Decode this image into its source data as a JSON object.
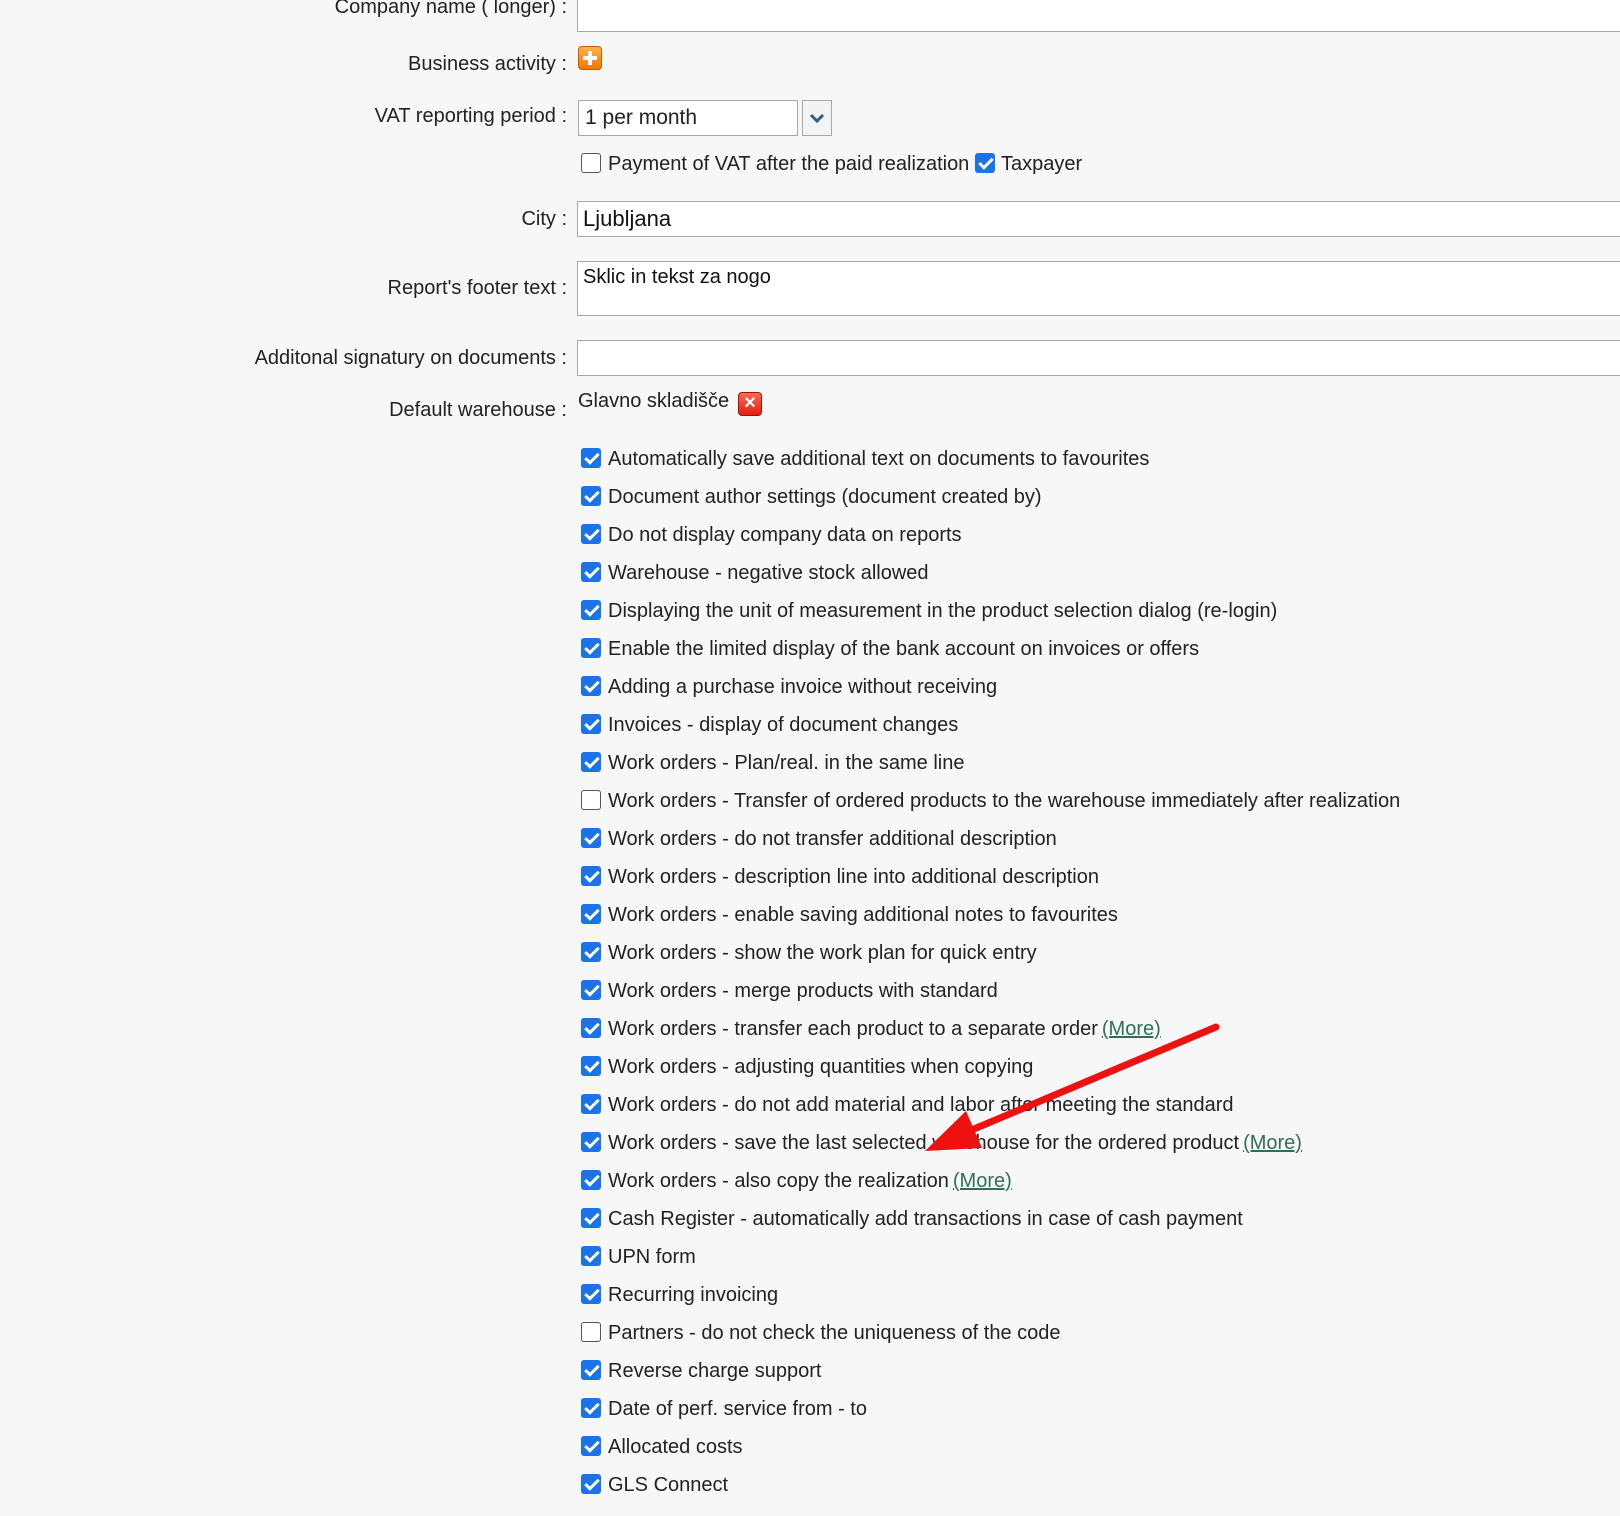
{
  "form": {
    "company_name_label": "Company name ( longer) :",
    "business_activity_label": "Business activity :",
    "vat_period_label": "VAT reporting period :",
    "vat_period_value": "1 per month",
    "payment_vat_label": "Payment of VAT after the paid realization",
    "taxpayer_label": "Taxpayer",
    "city_label": "City :",
    "city_value": "Ljubljana",
    "footer_label": "Report's footer text :",
    "footer_value": "Sklic in tekst za nogo",
    "signatory_label": "Additonal signatury on documents :",
    "warehouse_label": "Default warehouse :",
    "warehouse_value": "Glavno skladišče"
  },
  "more_label": "(More)",
  "options": [
    {
      "label": "Automatically save additional text on documents to favourites",
      "checked": true,
      "more": false
    },
    {
      "label": "Document author settings (document created by)",
      "checked": true,
      "more": false
    },
    {
      "label": "Do not display company data on reports",
      "checked": true,
      "more": false
    },
    {
      "label": "Warehouse - negative stock allowed",
      "checked": true,
      "more": false
    },
    {
      "label": "Displaying the unit of measurement in the product selection dialog (re-login)",
      "checked": true,
      "more": false
    },
    {
      "label": "Enable the limited display of the bank account on invoices or offers",
      "checked": true,
      "more": false
    },
    {
      "label": "Adding a purchase invoice without receiving",
      "checked": true,
      "more": false
    },
    {
      "label": "Invoices - display of document changes",
      "checked": true,
      "more": false
    },
    {
      "label": "Work orders - Plan/real. in the same line",
      "checked": true,
      "more": false
    },
    {
      "label": "Work orders - Transfer of ordered products to the warehouse immediately after realization",
      "checked": false,
      "more": false
    },
    {
      "label": "Work orders - do not transfer additional description",
      "checked": true,
      "more": false
    },
    {
      "label": "Work orders - description line into additional description",
      "checked": true,
      "more": false
    },
    {
      "label": "Work orders - enable saving additional notes to favourites",
      "checked": true,
      "more": false
    },
    {
      "label": "Work orders - show the work plan for quick entry",
      "checked": true,
      "more": false
    },
    {
      "label": "Work orders - merge products with standard",
      "checked": true,
      "more": false
    },
    {
      "label": "Work orders - transfer each product to a separate order",
      "checked": true,
      "more": true
    },
    {
      "label": "Work orders - adjusting quantities when copying",
      "checked": true,
      "more": false
    },
    {
      "label": "Work orders - do not add material and labor after meeting the standard",
      "checked": true,
      "more": false
    },
    {
      "label": "Work orders - save the last selected warehouse for the ordered product",
      "checked": true,
      "more": true
    },
    {
      "label": "Work orders - also copy the realization",
      "checked": true,
      "more": true
    },
    {
      "label": "Cash Register - automatically add transactions in case of cash payment",
      "checked": true,
      "more": false
    },
    {
      "label": "UPN form",
      "checked": true,
      "more": false
    },
    {
      "label": "Recurring invoicing",
      "checked": true,
      "more": false
    },
    {
      "label": "Partners - do not check the uniqueness of the code",
      "checked": false,
      "more": false
    },
    {
      "label": "Reverse charge support",
      "checked": true,
      "more": false
    },
    {
      "label": "Date of perf. service from - to",
      "checked": true,
      "more": false
    },
    {
      "label": "Allocated costs",
      "checked": true,
      "more": false
    },
    {
      "label": "GLS Connect",
      "checked": true,
      "more": false
    }
  ],
  "annotation": {
    "arrow_color": "#ee1111"
  }
}
